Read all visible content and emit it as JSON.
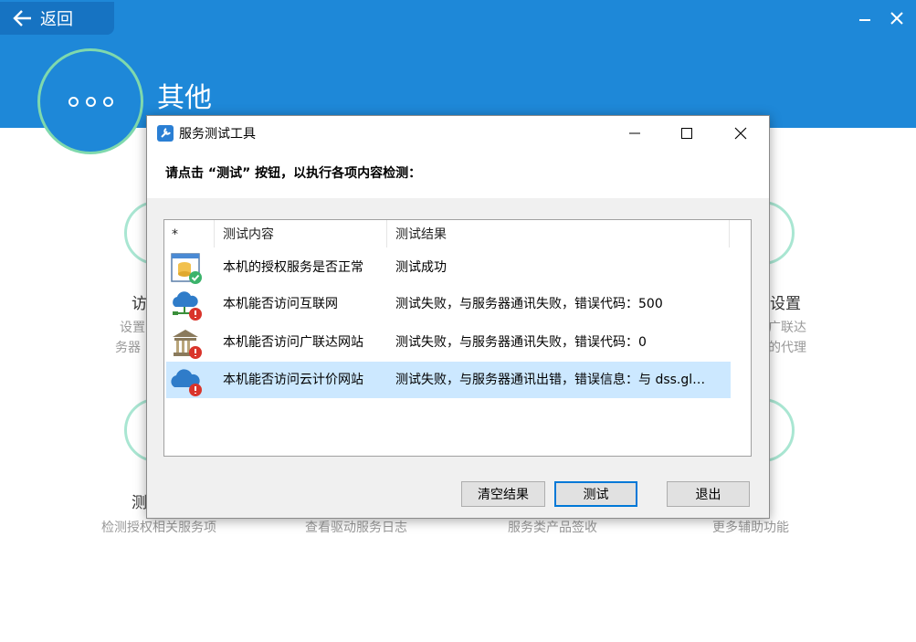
{
  "app": {
    "back_label": "返回",
    "page_title": "其他"
  },
  "tiles": {
    "access": {
      "title": "访",
      "desc1": "设置",
      "desc2": "务器"
    },
    "proxy": {
      "title": "设置",
      "desc1": "广联达",
      "desc2": "的代理"
    },
    "test": {
      "title": "测",
      "desc": "检测授权相关服务项"
    },
    "log": {
      "desc": "查看驱动服务日志"
    },
    "sign": {
      "desc": "服务类产品签收"
    },
    "more": {
      "desc": "更多辅助功能"
    }
  },
  "dialog": {
    "title": "服务测试工具",
    "instruction": "请点击 “测试” 按钮，以执行各项内容检测：",
    "columns": [
      "*",
      "测试内容",
      "测试结果"
    ],
    "rows": [
      {
        "icon": "database-check-icon",
        "content": "本机的授权服务是否正常",
        "result": "测试成功"
      },
      {
        "icon": "cloud-network-error-icon",
        "content": "本机能否访问互联网",
        "result": "测试失败，与服务器通讯失败，错误代码：500"
      },
      {
        "icon": "bank-building-error-icon",
        "content": "本机能否访问广联达网站",
        "result": "测试失败，与服务器通讯失败，错误代码：0"
      },
      {
        "icon": "cloud-error-icon",
        "content": "本机能否访问云计价网站",
        "result": "测试失败，与服务器通讯出错，错误信息：与 dss.gl…"
      }
    ],
    "buttons": {
      "clear": "清空结果",
      "test": "测试",
      "exit": "退出"
    }
  },
  "colors": {
    "header_blue": "#1e88d8",
    "selected_row": "#cce8ff",
    "error_red": "#d9342b",
    "success_green": "#3bb36b"
  }
}
